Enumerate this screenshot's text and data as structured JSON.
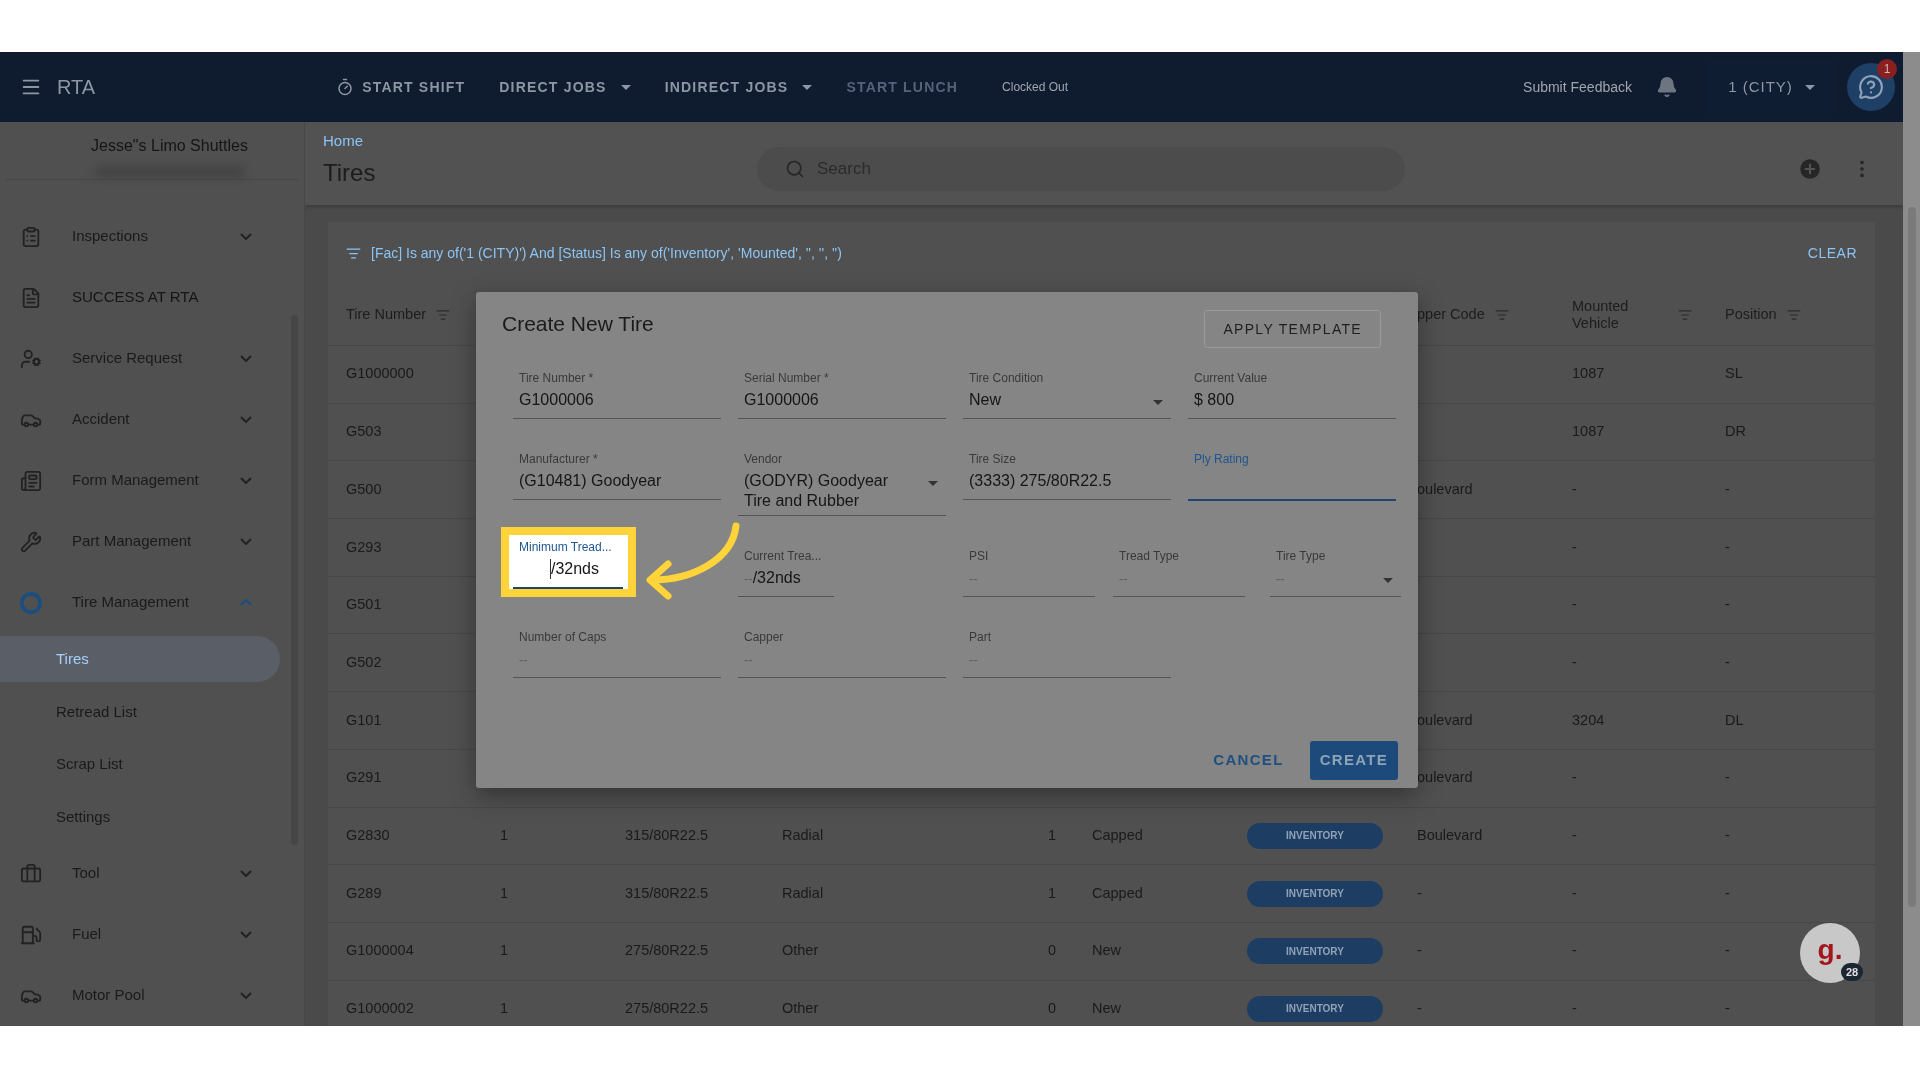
{
  "header": {
    "app_name": "RTA",
    "nav": [
      {
        "label": "START SHIFT",
        "kind": "timer",
        "disabled": false
      },
      {
        "label": "DIRECT JOBS",
        "kind": "dropdown",
        "disabled": false
      },
      {
        "label": "INDIRECT JOBS",
        "kind": "dropdown",
        "disabled": false
      },
      {
        "label": "START LUNCH",
        "kind": "plain",
        "disabled": true
      }
    ],
    "status": "Clocked Out",
    "feedback": "Submit Feedback",
    "facility": "1 (CITY)",
    "help_badge": "1"
  },
  "sidebar": {
    "company": "Jesse\"s Limo Shuttles",
    "items": [
      {
        "label": "Inspections",
        "kind": "group",
        "expanded": false
      },
      {
        "label": "SUCCESS AT RTA",
        "kind": "link"
      },
      {
        "label": "Service Request",
        "kind": "group",
        "expanded": false
      },
      {
        "label": "Accident",
        "kind": "group",
        "expanded": false
      },
      {
        "label": "Form Management",
        "kind": "group",
        "expanded": false
      },
      {
        "label": "Part Management",
        "kind": "group",
        "expanded": false
      },
      {
        "label": "Tire Management",
        "kind": "group",
        "expanded": true,
        "children": [
          {
            "label": "Tires",
            "selected": true
          },
          {
            "label": "Retread List",
            "selected": false
          },
          {
            "label": "Scrap List",
            "selected": false
          },
          {
            "label": "Settings",
            "selected": false
          }
        ]
      },
      {
        "label": "Tool",
        "kind": "group",
        "expanded": false
      },
      {
        "label": "Fuel",
        "kind": "group",
        "expanded": false
      },
      {
        "label": "Motor Pool",
        "kind": "group",
        "expanded": false
      }
    ]
  },
  "page": {
    "breadcrumb": "Home",
    "title": "Tires",
    "search_placeholder": "Search"
  },
  "table": {
    "filter": "[Fac] Is any of('1 (CITY)') And [Status] Is any of('Inventory', 'Mounted', '', '', '')",
    "clear": "CLEAR",
    "columns": {
      "tire_number": "Tire Number",
      "column_8": "pper Code",
      "mounted_vehicle": "Mounted Vehicle",
      "position": "Position"
    },
    "rows": [
      {
        "tire_number": "G1000000",
        "mounted_vehicle": "1087",
        "position": "SL"
      },
      {
        "tire_number": "G503",
        "mounted_vehicle": "1087",
        "position": "DR"
      },
      {
        "tire_number": "G500",
        "column_8": "oulevard",
        "mounted_vehicle": "-",
        "position": "-"
      },
      {
        "tire_number": "G293",
        "mounted_vehicle": "-",
        "position": "-"
      },
      {
        "tire_number": "G501",
        "mounted_vehicle": "-",
        "position": "-"
      },
      {
        "tire_number": "G502",
        "mounted_vehicle": "-",
        "position": "-"
      },
      {
        "tire_number": "G101",
        "column_8": "oulevard",
        "mounted_vehicle": "3204",
        "position": "DL"
      },
      {
        "tire_number": "G291",
        "column_8": "oulevard",
        "mounted_vehicle": "-",
        "position": "-"
      },
      {
        "tire_number": "G2830",
        "column_2": "1",
        "column_3": "315/80R22.5",
        "column_4": "Radial",
        "column_5": "1",
        "column_6": "Capped",
        "status": "INVENTORY",
        "column_8": "Boulevard",
        "mounted_vehicle": "-",
        "position": "-"
      },
      {
        "tire_number": "G289",
        "column_2": "1",
        "column_3": "315/80R22.5",
        "column_4": "Radial",
        "column_5": "1",
        "column_6": "Capped",
        "status": "INVENTORY",
        "column_8": "-",
        "mounted_vehicle": "-",
        "position": "-"
      },
      {
        "tire_number": "G1000004",
        "column_2": "1",
        "column_3": "275/80R22.5",
        "column_4": "Other",
        "column_5": "0",
        "column_6": "New",
        "status": "INVENTORY",
        "column_8": "-",
        "mounted_vehicle": "-",
        "position": "-"
      },
      {
        "tire_number": "G1000002",
        "column_2": "1",
        "column_3": "275/80R22.5",
        "column_4": "Other",
        "column_5": "0",
        "column_6": "New",
        "status": "INVENTORY",
        "column_8": "-",
        "mounted_vehicle": "-",
        "position": "-"
      }
    ]
  },
  "dialog": {
    "title": "Create New Tire",
    "template_button": "APPLY TEMPLATE",
    "rows": [
      [
        {
          "label": "Tire Number *",
          "value": "G1000006",
          "dropdown": false,
          "focused": false
        },
        {
          "label": "Serial Number *",
          "value": "G1000006",
          "dropdown": false,
          "focused": false
        },
        {
          "label": "Tire Condition",
          "value": "New",
          "dropdown": true,
          "focused": false
        },
        {
          "label": "Current Value",
          "value": "$ 800",
          "dropdown": false,
          "focused": false
        }
      ],
      [
        {
          "label": "Manufacturer *",
          "value": "(G10481) Goodyear",
          "dropdown": false,
          "focused": false
        },
        {
          "label": "Vendor",
          "value": "(GODYR) Goodyear Tire and Rubber",
          "dropdown": true,
          "focused": false
        },
        {
          "label": "Tire Size",
          "value": "(3333) 275/80R22.5",
          "dropdown": false,
          "focused": false
        },
        {
          "label": "Ply Rating",
          "dropdown": false,
          "focused": true
        }
      ],
      [
        {
          "label": "Minimum Tread...",
          "suffix": "/32nds",
          "dropdown": false,
          "focused": true,
          "highlighted": true
        },
        {
          "label": "Current Trea...",
          "placeholder": "--",
          "suffix": "/32nds",
          "dropdown": false,
          "focused": false
        },
        {
          "label": "PSI",
          "placeholder": "--",
          "dropdown": false,
          "focused": false
        },
        {
          "label": "Tread Type",
          "placeholder": "--",
          "dropdown": false,
          "focused": false
        },
        {
          "label": "Tire Type",
          "placeholder": "--",
          "dropdown": true,
          "focused": false
        }
      ],
      [
        {
          "label": "Number of Caps",
          "placeholder": "--",
          "dropdown": false,
          "focused": false
        },
        {
          "label": "Capper",
          "placeholder": "--",
          "dropdown": false,
          "focused": false
        },
        {
          "label": "Part",
          "placeholder": "--",
          "dropdown": false,
          "focused": false
        }
      ]
    ],
    "cancel": "CANCEL",
    "create": "CREATE"
  },
  "widget": {
    "logo_text": "g.",
    "badge": "28"
  }
}
